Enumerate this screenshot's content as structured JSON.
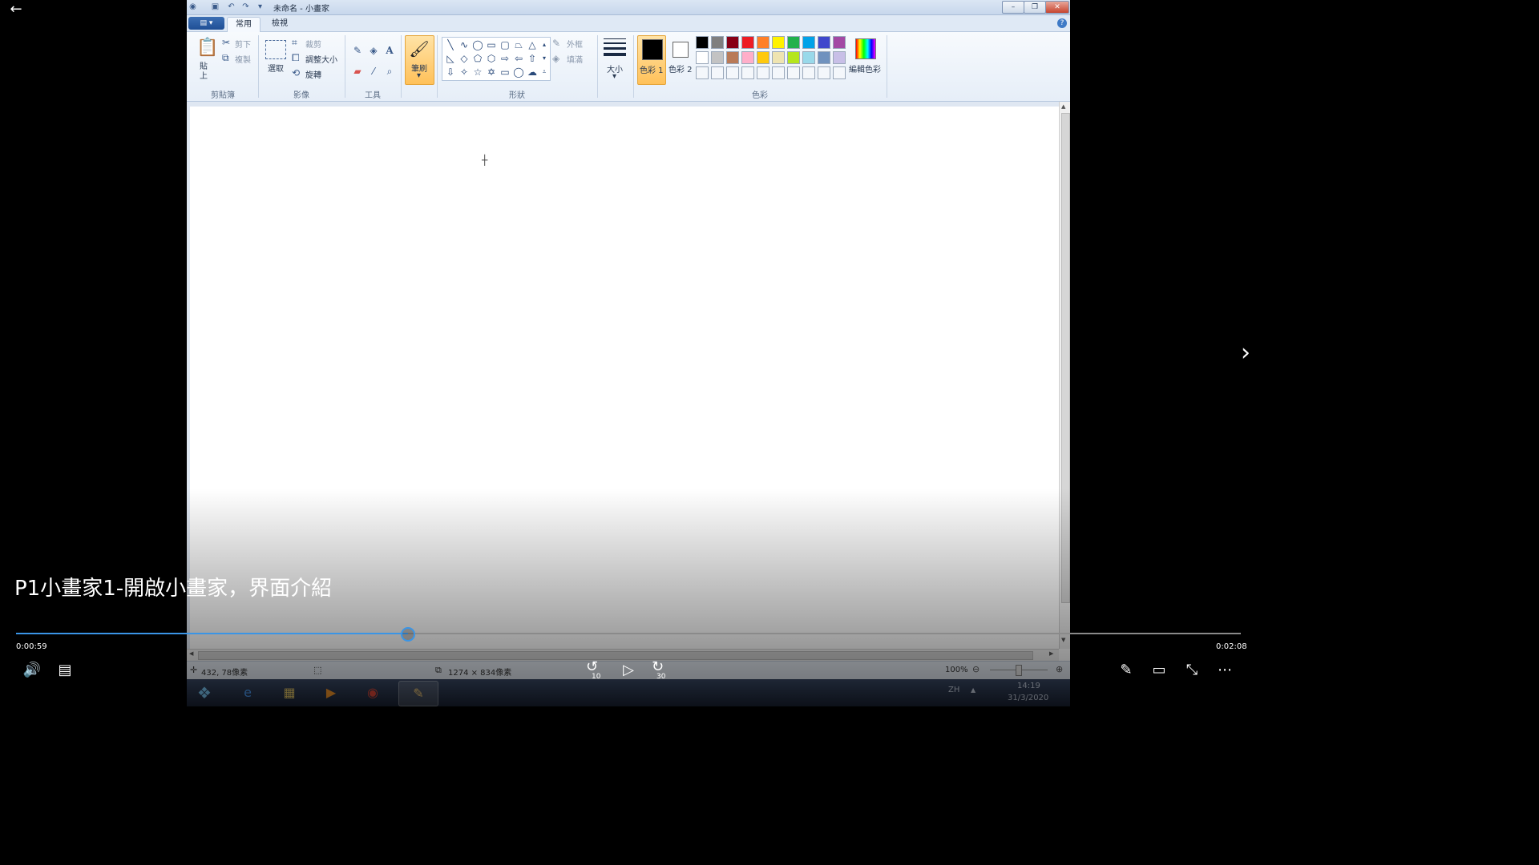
{
  "player": {
    "back_glyph": "←",
    "next_glyph": "›",
    "video_title": "P1小畫家1-開啟小畫家，界面介紹",
    "progress_fraction": 0.32,
    "elapsed": "0:00:59",
    "duration": "0:02:08",
    "volume_glyph": "🔊",
    "captions_glyph": "▤",
    "rewind_label": "10",
    "forward_label": "30",
    "play_glyph": "▷",
    "pen_glyph": "✎",
    "miniview_glyph": "▭",
    "exit_full_glyph": "⤡",
    "more_glyph": "⋯"
  },
  "paint": {
    "window_title": "未命名 - 小畫家",
    "tabs": {
      "home": "常用",
      "view": "檢視"
    },
    "clipboard": {
      "paste": "貼上",
      "cut": "剪下",
      "copy": "複製",
      "group": "剪貼簿"
    },
    "image": {
      "select": "選取",
      "crop": "裁剪",
      "resize": "調整大小",
      "rotate": "旋轉",
      "group": "影像"
    },
    "tools": {
      "group": "工具"
    },
    "brushes": {
      "label": "筆刷"
    },
    "shapes": {
      "outline": "外框",
      "fill": "填滿",
      "group": "形狀"
    },
    "size": {
      "label": "大小"
    },
    "colors": {
      "color1": "色彩 1",
      "color2": "色彩 2",
      "edit": "編輯色彩",
      "group": "色彩",
      "row1": [
        "#000000",
        "#7f7f7f",
        "#880015",
        "#ed1c24",
        "#ff7f27",
        "#fff200",
        "#22b14c",
        "#00a2e8",
        "#3f48cc",
        "#a349a4"
      ],
      "row2": [
        "#ffffff",
        "#c3c3c3",
        "#b97a57",
        "#ffaec9",
        "#ffc90e",
        "#efe4b0",
        "#b5e61d",
        "#99d9ea",
        "#7092be",
        "#c8bfe7"
      ]
    },
    "status": {
      "cursor_pos": "432, 78像素",
      "canvas_size": "1274 × 834像素",
      "zoom": "100%"
    },
    "taskbar": {
      "lang": "ZH",
      "time": "14:19",
      "date": "31/3/2020"
    }
  }
}
